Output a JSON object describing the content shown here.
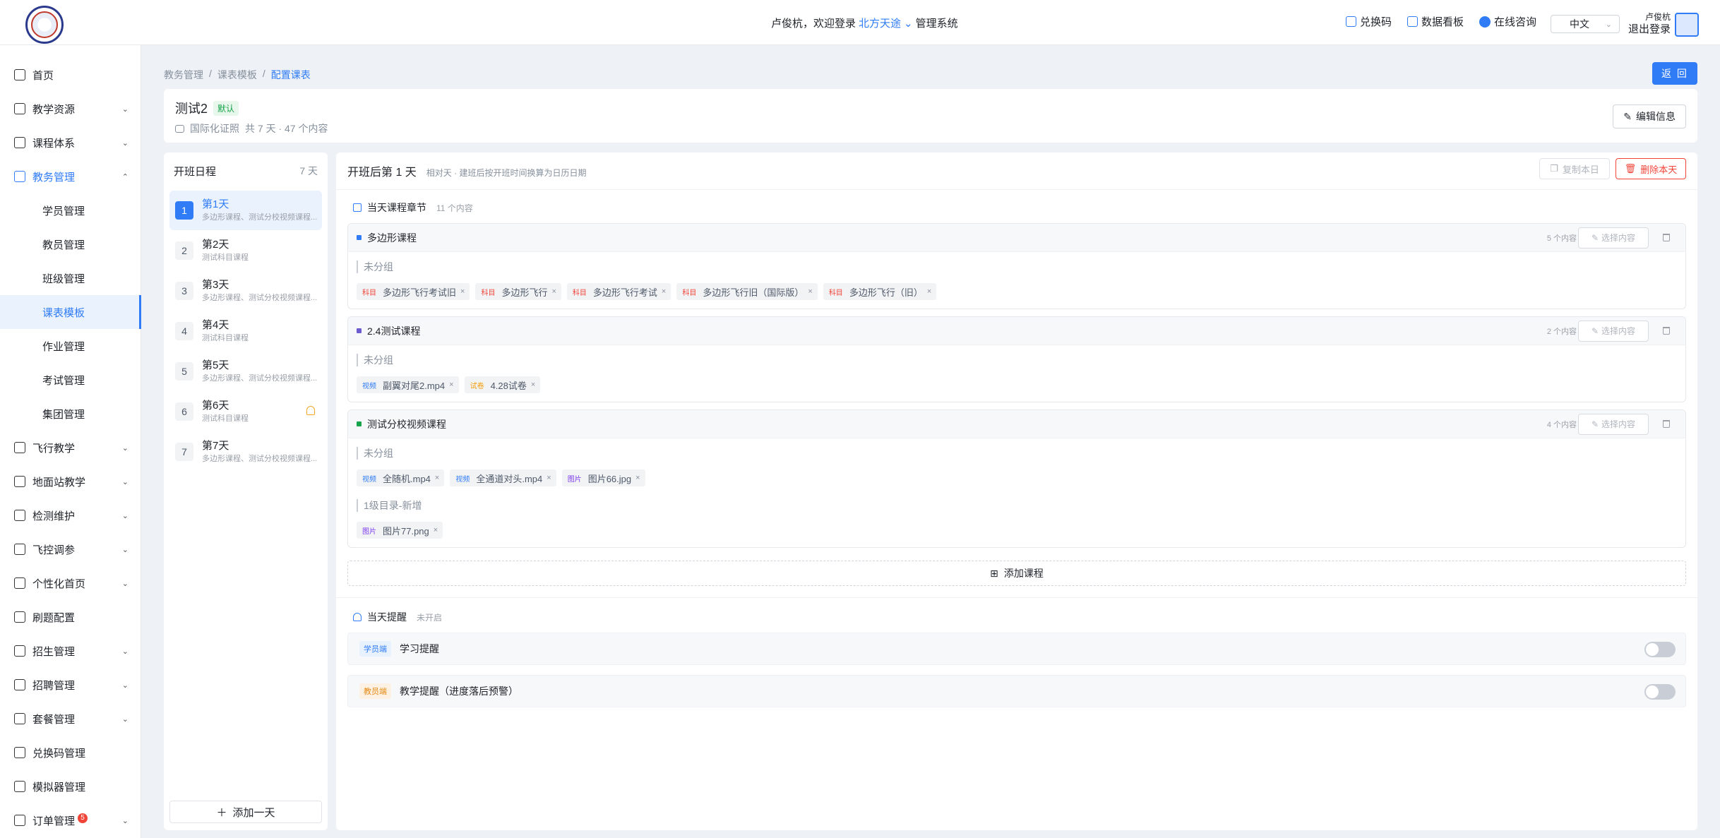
{
  "header": {
    "welcome_prefix": "卢俊杭，欢迎登录",
    "brand": "北方天途",
    "system": "管理系统",
    "actions": [
      "兑换码",
      "数据看板",
      "在线咨询"
    ],
    "lang": "中文",
    "username": "卢俊杭",
    "logout": "退出登录"
  },
  "sidebar": {
    "items": [
      {
        "label": "首页",
        "icon": "home-icon"
      },
      {
        "label": "教学资源",
        "icon": "book-icon",
        "chev": "⌄"
      },
      {
        "label": "课程体系",
        "icon": "hierarchy-icon",
        "chev": "⌄"
      },
      {
        "label": "教务管理",
        "icon": "grid-icon",
        "chev": "⌃"
      },
      {
        "label": "学员管理"
      },
      {
        "label": "教员管理"
      },
      {
        "label": "班级管理"
      },
      {
        "label": "课表模板"
      },
      {
        "label": "作业管理"
      },
      {
        "label": "考试管理"
      },
      {
        "label": "集团管理"
      },
      {
        "label": "飞行教学",
        "icon": "drone-icon",
        "chev": "⌄"
      },
      {
        "label": "地面站教学",
        "icon": "station-icon",
        "chev": "⌄"
      },
      {
        "label": "检测维护",
        "icon": "tools-icon",
        "chev": "⌄"
      },
      {
        "label": "飞控调参",
        "icon": "control-icon",
        "chev": "⌄"
      },
      {
        "label": "个性化首页",
        "icon": "page-icon",
        "chev": "⌄"
      },
      {
        "label": "刷题配置",
        "icon": "quiz-icon"
      },
      {
        "label": "招生管理",
        "icon": "enroll-icon",
        "chev": "⌄"
      },
      {
        "label": "招聘管理",
        "icon": "briefcase-icon",
        "chev": "⌄"
      },
      {
        "label": "套餐管理",
        "icon": "package-icon",
        "chev": "⌄"
      },
      {
        "label": "兑换码管理",
        "icon": "qrcode-icon"
      },
      {
        "label": "模拟器管理",
        "icon": "laptop-icon"
      },
      {
        "label": "订单管理",
        "icon": "order-icon",
        "chev": "⌄",
        "badge": "5"
      }
    ]
  },
  "breadcrumb": [
    "教务管理",
    "/",
    "课表模板",
    "/",
    "配置课表"
  ],
  "back_label": "返 回",
  "info": {
    "title": "测试2",
    "tag": "默认",
    "cert": "国际化证照",
    "summary": "共 7 天 · 47 个内容",
    "edit_label": "编辑信息"
  },
  "schedule": {
    "title": "开班日程",
    "count": "7 天",
    "days": [
      {
        "num": "1",
        "title": "第1天",
        "desc": "多边形课程、测试分校视频课程..."
      },
      {
        "num": "2",
        "title": "第2天",
        "desc": "测试科目课程"
      },
      {
        "num": "3",
        "title": "第3天",
        "desc": "多边形课程、测试分校视频课程..."
      },
      {
        "num": "4",
        "title": "第4天",
        "desc": "测试科目课程"
      },
      {
        "num": "5",
        "title": "第5天",
        "desc": "多边形课程、测试分校视频课程..."
      },
      {
        "num": "6",
        "title": "第6天",
        "desc": "测试科目课程"
      },
      {
        "num": "7",
        "title": "第7天",
        "desc": "多边形课程、测试分校视频课程..."
      }
    ],
    "add_label": "添加一天"
  },
  "main": {
    "title": "开班后第 1 天",
    "hint": "相对天 · 建班后按开班时间换算为日历日期",
    "copy_label": "复制本日",
    "delete_label": "删除本天",
    "section_title": "当天课程章节",
    "section_count": "11 个内容",
    "courses": [
      {
        "name": "多边形课程",
        "dot": "#2f7cf6",
        "count": "5 个内容",
        "pick": "选择内容",
        "groups": [
          {
            "name": "未分组",
            "chips": [
              {
                "kind": "科目",
                "label": "多边形飞行考试旧"
              },
              {
                "kind": "科目",
                "label": "多边形飞行"
              },
              {
                "kind": "科目",
                "label": "多边形飞行考试"
              },
              {
                "kind": "科目",
                "label": "多边形飞行旧（国际版）"
              },
              {
                "kind": "科目",
                "label": "多边形飞行（旧）"
              }
            ]
          }
        ]
      },
      {
        "name": "2.4测试课程",
        "dot": "#6d5bd0",
        "count": "2 个内容",
        "pick": "选择内容",
        "groups": [
          {
            "name": "未分组",
            "chips": [
              {
                "kind": "视频",
                "label": "副翼对尾2.mp4"
              },
              {
                "kind": "试卷",
                "label": "4.28试卷"
              }
            ]
          }
        ]
      },
      {
        "name": "测试分校视频课程",
        "dot": "#16a34a",
        "count": "4 个内容",
        "pick": "选择内容",
        "groups": [
          {
            "name": "未分组",
            "chips": [
              {
                "kind": "视频",
                "label": "全随机.mp4"
              },
              {
                "kind": "视频",
                "label": "全通道对头.mp4"
              },
              {
                "kind": "图片",
                "label": "图片66.jpg"
              }
            ]
          },
          {
            "name": "1级目录-新增",
            "chips": [
              {
                "kind": "图片",
                "label": "图片77.png"
              }
            ]
          }
        ]
      }
    ],
    "add_course_label": "添加课程",
    "remind_title": "当天提醒",
    "remind_status": "未开启",
    "reminders": [
      {
        "role": "学员端",
        "label": "学习提醒"
      },
      {
        "role": "教员端",
        "label": "教学提醒（进度落后预警）"
      }
    ]
  }
}
